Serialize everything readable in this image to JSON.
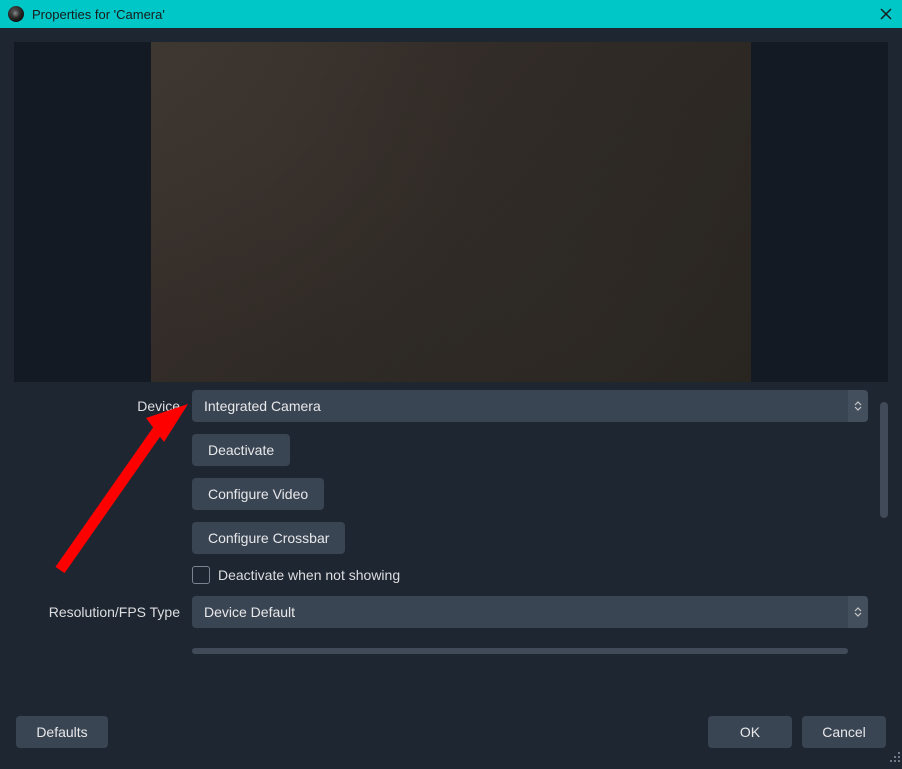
{
  "titlebar": {
    "title": "Properties for 'Camera'"
  },
  "labels": {
    "device": "Device",
    "resolution_type": "Resolution/FPS Type"
  },
  "device": {
    "selected": "Integrated Camera"
  },
  "resolution": {
    "selected": "Device Default"
  },
  "buttons": {
    "deactivate": "Deactivate",
    "configure_video": "Configure Video",
    "configure_crossbar": "Configure Crossbar",
    "defaults": "Defaults",
    "ok": "OK",
    "cancel": "Cancel"
  },
  "checkbox": {
    "deactivate_when_not_showing": "Deactivate when not showing"
  }
}
